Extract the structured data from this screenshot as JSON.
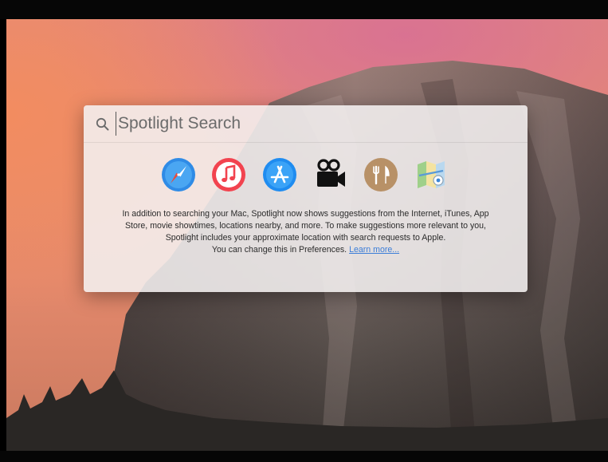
{
  "spotlight": {
    "search_placeholder": "Spotlight Search",
    "search_value": "",
    "suggestion_icons": [
      {
        "name": "safari-icon"
      },
      {
        "name": "itunes-icon"
      },
      {
        "name": "app-store-icon"
      },
      {
        "name": "movies-icon"
      },
      {
        "name": "restaurants-icon"
      },
      {
        "name": "maps-icon"
      }
    ],
    "intro_text": "In addition to searching your Mac, Spotlight now shows suggestions from the Internet, iTunes, App Store, movie showtimes, locations nearby, and more. To make suggestions more relevant to you, Spotlight includes your approximate location with search requests to Apple.",
    "preferences_text": "You can change this in Preferences.",
    "learn_more_label": "Learn more..."
  },
  "colors": {
    "link": "#3b7dd8",
    "safari": "#2f8be6",
    "itunes": "#f2434f",
    "app_store": "#1f8cf0",
    "restaurants": "#b89167"
  }
}
